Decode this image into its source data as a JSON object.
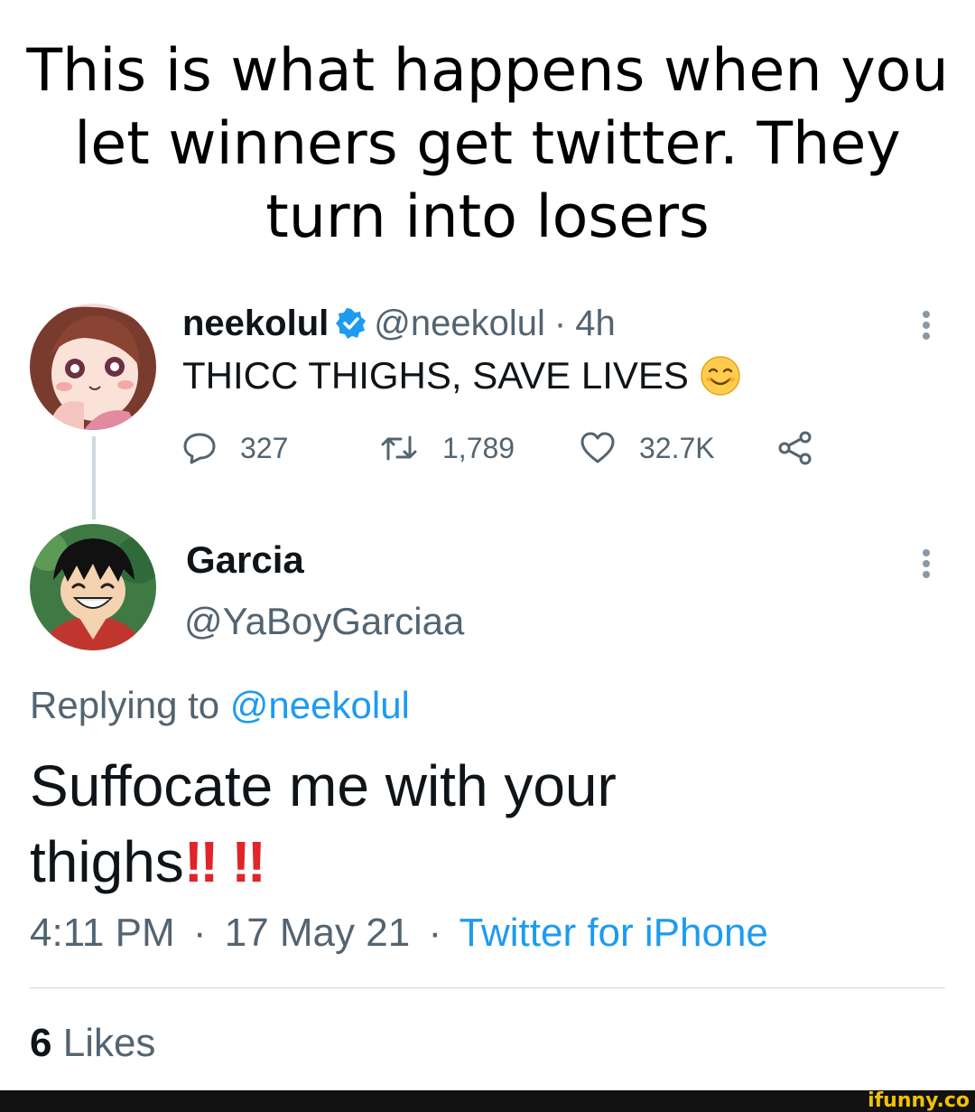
{
  "caption": "This is what happens when you let winners get twitter. They turn into losers",
  "tweet1": {
    "name": "neekolul",
    "handle": "@neekolul",
    "sep": "·",
    "time": "4h",
    "text": "THICC THIGHS, SAVE LIVES",
    "emoji": "smiling-face-icon",
    "replies": "327",
    "retweets": "1,789",
    "likes": "32.7K"
  },
  "tweet2": {
    "name": "Garcia",
    "handle": "@YaBoyGarciaa",
    "replying_prefix": "Replying to",
    "replying_handle": "@neekolul",
    "text": "Suffocate me with your thighs",
    "emphasis": "‼ ‼",
    "time": "4:11 PM",
    "sep1": "·",
    "date": "17 May 21",
    "sep2": "·",
    "source": "Twitter for iPhone",
    "likes_count": "6",
    "likes_label": "Likes"
  },
  "watermark": "ifunny.co",
  "colors": {
    "link": "#1d9bf0",
    "muted": "#536471",
    "text": "#0f1419",
    "emphasis": "#e0242a",
    "watermark": "#f2c200"
  }
}
